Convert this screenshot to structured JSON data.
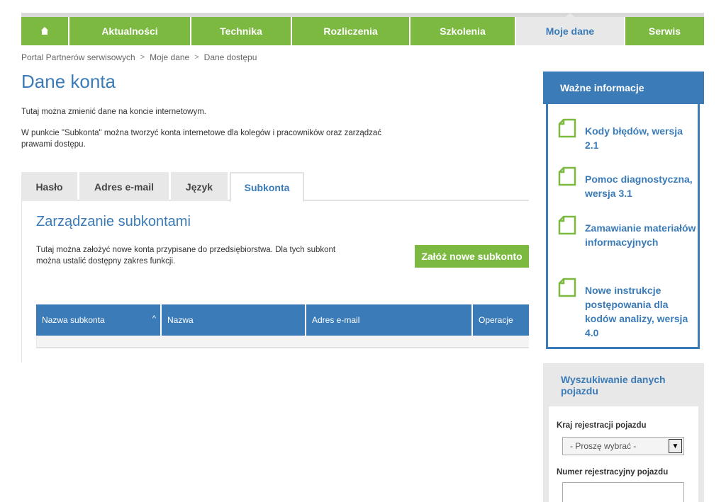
{
  "nav": {
    "home_icon": "home-icon",
    "items": [
      {
        "label": "Aktualności"
      },
      {
        "label": "Technika"
      },
      {
        "label": "Rozliczenia"
      },
      {
        "label": "Szkolenia"
      },
      {
        "label": "Moje dane",
        "active": true
      },
      {
        "label": "Serwis"
      }
    ]
  },
  "breadcrumb": [
    "Portal Partnerów serwisowych",
    "Moje dane",
    "Dane dostępu"
  ],
  "page": {
    "title": "Dane konta",
    "intro1": "Tutaj można zmienić dane na koncie internetowym.",
    "intro2": "W punkcie \"Subkonta\" można tworzyć konta internetowe dla kolegów i pracowników oraz zarządzać prawami dostępu."
  },
  "tabs": [
    {
      "label": "Hasło"
    },
    {
      "label": "Adres e-mail"
    },
    {
      "label": "Język"
    },
    {
      "label": "Subkonta",
      "active": true
    }
  ],
  "subaccounts": {
    "title": "Zarządzanie subkontami",
    "text": "Tutaj można założyć nowe konta przypisane do przedsiębiorstwa. Dla tych subkont można ustalić dostępny zakres funkcji.",
    "create_button": "Załóż nowe subkonto",
    "columns": [
      "Nazwa subkonta",
      "Nazwa",
      "Adres e-mail",
      "Operacje"
    ],
    "sort_indicator": "^"
  },
  "info": {
    "title": "Ważne informacje",
    "items": [
      {
        "label": "Kody błędów, wersja 2.1"
      },
      {
        "label": "Pomoc diagnostyczna, wersja 3.1"
      },
      {
        "label": "Zamawianie materiałów informacyjnych"
      },
      {
        "label": "Nowe instrukcje postępowania dla kodów analizy, wersja 4.0"
      }
    ]
  },
  "vehicle_search": {
    "title": "Wyszukiwanie danych pojazdu",
    "country_label": "Kraj rejestracji pojazdu",
    "country_value": "- Proszę wybrać -",
    "plate_label": "Numer rejestracyjny pojazdu",
    "plate_value": ""
  },
  "colors": {
    "green": "#7cb940",
    "blue": "#3a7bb8",
    "grey": "#e8e8e8"
  }
}
